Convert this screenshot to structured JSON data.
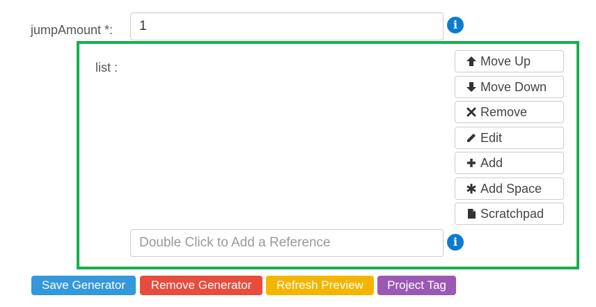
{
  "jump_amount": {
    "label": "jumpAmount *:",
    "value": "1",
    "info_icon": "info-circle-icon"
  },
  "list": {
    "label": "list :",
    "border_color": "#15b04a",
    "buttons": [
      {
        "label": "Move Up",
        "icon": "arrow-up-icon"
      },
      {
        "label": "Move Down",
        "icon": "arrow-down-icon"
      },
      {
        "label": "Remove",
        "icon": "x-icon"
      },
      {
        "label": "Edit",
        "icon": "pencil-icon"
      },
      {
        "label": "Add",
        "icon": "plus-icon"
      },
      {
        "label": "Add Space",
        "icon": "asterisk-icon"
      },
      {
        "label": "Scratchpad",
        "icon": "file-icon"
      }
    ],
    "reference_input": {
      "placeholder": "Double Click to Add a Reference",
      "value": ""
    },
    "info_icon": "info-circle-icon"
  },
  "footer": {
    "buttons": [
      {
        "label": "Save Generator",
        "color": "#3498db"
      },
      {
        "label": "Remove Generator",
        "color": "#e74c3c"
      },
      {
        "label": "Refresh Preview",
        "color": "#f5b400"
      },
      {
        "label": "Project Tag",
        "color": "#9b59b6"
      }
    ]
  }
}
